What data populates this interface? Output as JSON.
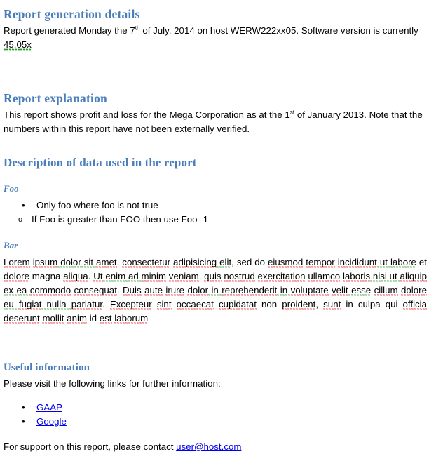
{
  "document": {
    "heading_color": "#4a7ebb",
    "link_color": "#0000ee",
    "spelling_underline_color": "#e00000",
    "grammar_underline_color": "#109010"
  },
  "generation": {
    "heading": "Report generation details",
    "line_prefix": "Report generated Monday the 7",
    "ordinal_th": "th",
    "line_mid": " of July, 2014  on host WERW222xx05.  Software version is currently ",
    "version": "45.05x"
  },
  "explanation": {
    "heading": "Report explanation",
    "line_prefix": "This report shows profit and loss for the Mega Corporation as at the 1",
    "ordinal_st": "st",
    "line_rest": " of January 2013.  Note that the numbers within this report have not been externally verified."
  },
  "description": {
    "heading": "Description of data used in the report",
    "foo": {
      "heading": "Foo",
      "bullet_level1": "Only foo where foo is not true",
      "bullet_marker_level1": "•",
      "bullet_level2": "If Foo is greater than FOO then use Foo -1",
      "bullet_marker_level2": "o"
    },
    "bar": {
      "heading": "Bar",
      "paragraph_tokens": [
        {
          "t": "Lorem",
          "m": "sp"
        },
        {
          "t": " ",
          "m": "none"
        },
        {
          "t": "ipsum",
          "m": "sp"
        },
        {
          "t": " ",
          "m": "gr"
        },
        {
          "t": "dolor",
          "m": "gr"
        },
        {
          "t": " sit ",
          "m": "gr"
        },
        {
          "t": "amet",
          "m": "sp"
        },
        {
          "t": ", ",
          "m": "none"
        },
        {
          "t": "consectetur",
          "m": "sp"
        },
        {
          "t": " ",
          "m": "none"
        },
        {
          "t": "adipisicing",
          "m": "sp"
        },
        {
          "t": " ",
          "m": "gr"
        },
        {
          "t": "elit",
          "m": "gr"
        },
        {
          "t": ", sed do ",
          "m": "none"
        },
        {
          "t": "eiusmod",
          "m": "sp"
        },
        {
          "t": " ",
          "m": "none"
        },
        {
          "t": "tempor",
          "m": "sp"
        },
        {
          "t": " ",
          "m": "none"
        },
        {
          "t": "incididunt",
          "m": "sp"
        },
        {
          "t": " ut ",
          "m": "gr"
        },
        {
          "t": "labore",
          "m": "gr"
        },
        {
          "t": " et ",
          "m": "none"
        },
        {
          "t": "dolore",
          "m": "sp"
        },
        {
          "t": " magna ",
          "m": "none"
        },
        {
          "t": "aliqua",
          "m": "sp"
        },
        {
          "t": ". ",
          "m": "none"
        },
        {
          "t": "Ut",
          "m": "sp"
        },
        {
          "t": " enim ad ",
          "m": "gr"
        },
        {
          "t": "minim",
          "m": "sp"
        },
        {
          "t": " ",
          "m": "none"
        },
        {
          "t": "veniam",
          "m": "sp"
        },
        {
          "t": ", ",
          "m": "none"
        },
        {
          "t": "quis",
          "m": "sp"
        },
        {
          "t": " ",
          "m": "none"
        },
        {
          "t": "nostrud",
          "m": "sp"
        },
        {
          "t": " ",
          "m": "none"
        },
        {
          "t": "exercitation",
          "m": "sp"
        },
        {
          "t": " ",
          "m": "none"
        },
        {
          "t": "ullamco",
          "m": "sp"
        },
        {
          "t": " ",
          "m": "none"
        },
        {
          "t": "laboris",
          "m": "sp"
        },
        {
          "t": " nisi ut ",
          "m": "gr"
        },
        {
          "t": "aliquip",
          "m": "sp"
        },
        {
          "t": " ex ea ",
          "m": "gr"
        },
        {
          "t": "commodo",
          "m": "sp"
        },
        {
          "t": " ",
          "m": "none"
        },
        {
          "t": "consequat",
          "m": "sp"
        },
        {
          "t": ". ",
          "m": "none"
        },
        {
          "t": "Duis",
          "m": "sp"
        },
        {
          "t": " ",
          "m": "none"
        },
        {
          "t": "aute",
          "m": "sp"
        },
        {
          "t": " ",
          "m": "none"
        },
        {
          "t": "irure",
          "m": "sp"
        },
        {
          "t": " ",
          "m": "none"
        },
        {
          "t": "dolor",
          "m": "sp"
        },
        {
          "t": " in ",
          "m": "gr"
        },
        {
          "t": "reprehenderit",
          "m": "sp"
        },
        {
          "t": " in ",
          "m": "gr"
        },
        {
          "t": "voluptate",
          "m": "sp"
        },
        {
          "t": " ",
          "m": "none"
        },
        {
          "t": "velit",
          "m": "sp"
        },
        {
          "t": " ",
          "m": "gr"
        },
        {
          "t": "esse",
          "m": "gr"
        },
        {
          "t": " ",
          "m": "none"
        },
        {
          "t": "cillum",
          "m": "sp"
        },
        {
          "t": " ",
          "m": "none"
        },
        {
          "t": "dolore",
          "m": "sp"
        },
        {
          "t": " eu ",
          "m": "gr"
        },
        {
          "t": "fugiat",
          "m": "sp"
        },
        {
          "t": " nulla ",
          "m": "gr"
        },
        {
          "t": "pariatur",
          "m": "sp"
        },
        {
          "t": ". ",
          "m": "none"
        },
        {
          "t": "Excepteur",
          "m": "sp"
        },
        {
          "t": " ",
          "m": "none"
        },
        {
          "t": "sint",
          "m": "sp"
        },
        {
          "t": " ",
          "m": "none"
        },
        {
          "t": "occaecat",
          "m": "sp"
        },
        {
          "t": " ",
          "m": "none"
        },
        {
          "t": "cupidatat",
          "m": "sp"
        },
        {
          "t": " non ",
          "m": "none"
        },
        {
          "t": "proident",
          "m": "sp"
        },
        {
          "t": ", ",
          "m": "none"
        },
        {
          "t": "sunt",
          "m": "sp"
        },
        {
          "t": " in culpa qui ",
          "m": "none"
        },
        {
          "t": "officia",
          "m": "sp"
        },
        {
          "t": " ",
          "m": "none"
        },
        {
          "t": "deserunt",
          "m": "sp"
        },
        {
          "t": " ",
          "m": "none"
        },
        {
          "t": "mollit",
          "m": "sp"
        },
        {
          "t": " ",
          "m": "none"
        },
        {
          "t": "anim",
          "m": "sp"
        },
        {
          "t": " id ",
          "m": "none"
        },
        {
          "t": "est",
          "m": "sp"
        },
        {
          "t": " ",
          "m": "none"
        },
        {
          "t": "laborum",
          "m": "sp"
        }
      ]
    }
  },
  "useful": {
    "heading": "Useful information",
    "intro": "Please visit the following links for further information:",
    "bullet_marker": "•",
    "links": [
      {
        "label": "GAAP"
      },
      {
        "label": "Google"
      }
    ],
    "support_prefix": "For support on this report, please contact ",
    "support_email": "user@host.com"
  }
}
